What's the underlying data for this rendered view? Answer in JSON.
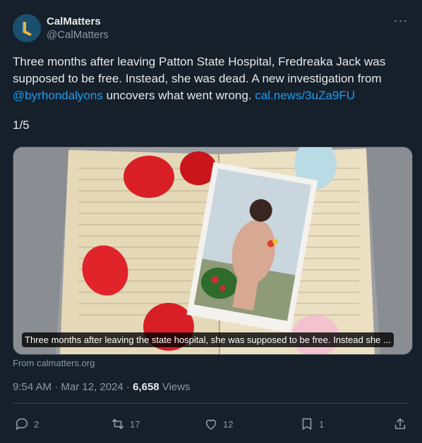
{
  "author": {
    "name": "CalMatters",
    "handle": "@CalMatters"
  },
  "tweet": {
    "text_before": "Three months after leaving Patton State Hospital, Fredreaka Jack was supposed to be free. Instead, she was dead. A new investigation from ",
    "mention": "@byrhondalyons",
    "text_middle": " uncovers what went wrong. ",
    "link": "cal.news/3uZa9FU",
    "counter": "1/5"
  },
  "media": {
    "caption": "Three months after leaving the state hospital, she was supposed to be free. Instead she ...",
    "source": "From calmatters.org"
  },
  "meta": {
    "time_date": "9:54 AM · Mar 12, 2024 · ",
    "views_count": "6,658",
    "views_label": " Views"
  },
  "actions": {
    "replies": "2",
    "reposts": "17",
    "likes": "12",
    "bookmarks": "1"
  },
  "colors": {
    "background": "#15202b",
    "link": "#1d9bf0",
    "muted": "#8b98a5"
  }
}
